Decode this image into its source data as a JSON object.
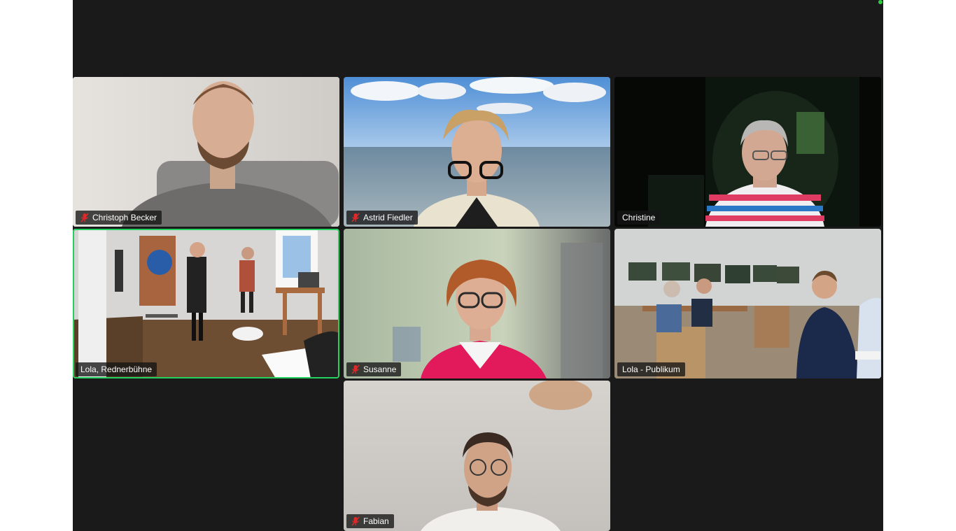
{
  "participants": [
    {
      "name": "Christoph Becker",
      "muted": true,
      "speaking": false
    },
    {
      "name": "Astrid Fiedler",
      "muted": true,
      "speaking": false
    },
    {
      "name": "Christine",
      "muted": false,
      "speaking": false
    },
    {
      "name": "Lola, Rednerbühne",
      "muted": false,
      "speaking": true
    },
    {
      "name": "Susanne",
      "muted": true,
      "speaking": false
    },
    {
      "name": "Lola - Publikum",
      "muted": false,
      "speaking": false
    },
    {
      "name": "Fabian",
      "muted": true,
      "speaking": false
    }
  ],
  "colors": {
    "background": "#1a1a1a",
    "active_speaker": "#23d160",
    "mute_icon": "#e02828",
    "status_dot": "#2ecc40"
  },
  "icons": {
    "muted": "mic-muted-icon",
    "status": "status-dot-icon"
  }
}
